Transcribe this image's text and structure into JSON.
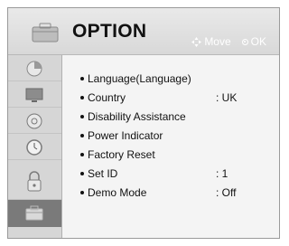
{
  "header": {
    "title": "OPTION",
    "move_hint": "Move",
    "ok_hint": "OK"
  },
  "sidebar": {
    "items": [
      {
        "icon": "picture-icon"
      },
      {
        "icon": "tv-screen-icon"
      },
      {
        "icon": "audio-icon"
      },
      {
        "icon": "clock-icon"
      },
      {
        "icon": "lock-icon"
      },
      {
        "icon": "option-icon",
        "active": true
      }
    ]
  },
  "menu": {
    "items": [
      {
        "label": "Language(Language)",
        "value": ""
      },
      {
        "label": "Country",
        "value": ": UK"
      },
      {
        "label": "Disability Assistance",
        "value": ""
      },
      {
        "label": "Power Indicator",
        "value": ""
      },
      {
        "label": "Factory Reset",
        "value": ""
      },
      {
        "label": "Set ID",
        "value": ": 1"
      },
      {
        "label": "Demo Mode",
        "value": ": Off"
      }
    ]
  },
  "colors": {
    "header_bg": "#e0e0e0",
    "sidebar_bg": "#d6d6d6",
    "active_item_bg": "#7a7a7a",
    "content_bg": "#f4f4f4"
  }
}
